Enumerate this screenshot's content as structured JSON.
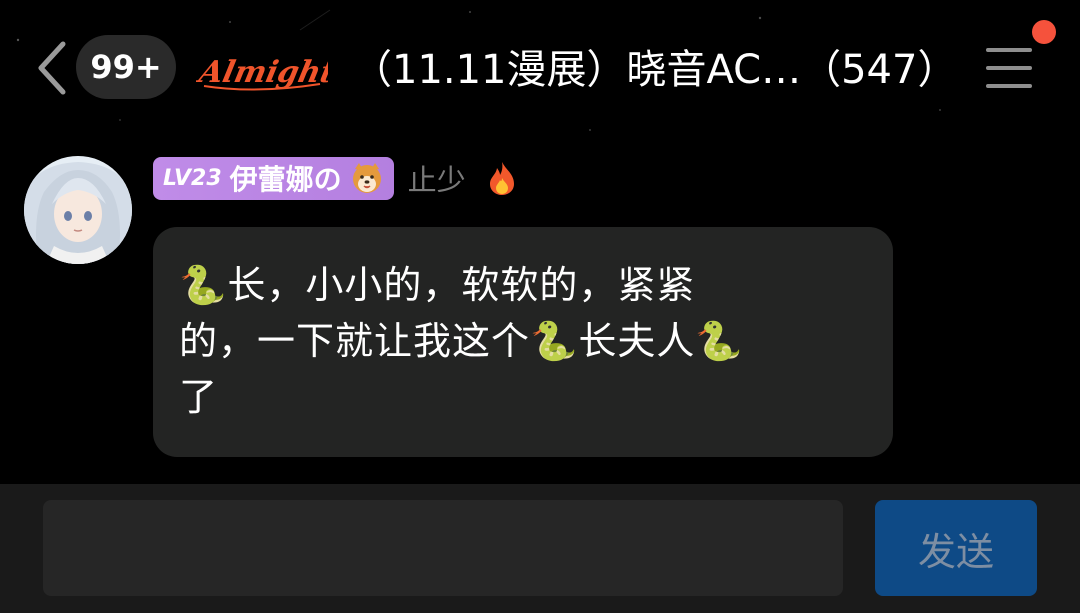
{
  "header": {
    "unread_count": "99+",
    "logo_text": "Almighty",
    "group_title": "（11.11漫展）晓音AC…（547）",
    "has_notification": true
  },
  "message": {
    "level": "LV23",
    "sender_name": "伊蕾娜の",
    "sender_emoji": "dog-face",
    "sender_title": "止少",
    "title_icon": "fire",
    "text": "🐍长，小小的，软软的，紧紧\n的，一下就让我这个🐍长夫人🐍\n了"
  },
  "composer": {
    "input_value": "",
    "input_placeholder": "",
    "send_label": "发送"
  },
  "colors": {
    "background": "#000000",
    "bubble": "#232423",
    "level_tag": "#c08ce8",
    "send_button": "#0e4a86",
    "notify_dot": "#f5523c",
    "logo": "#f0542b"
  }
}
